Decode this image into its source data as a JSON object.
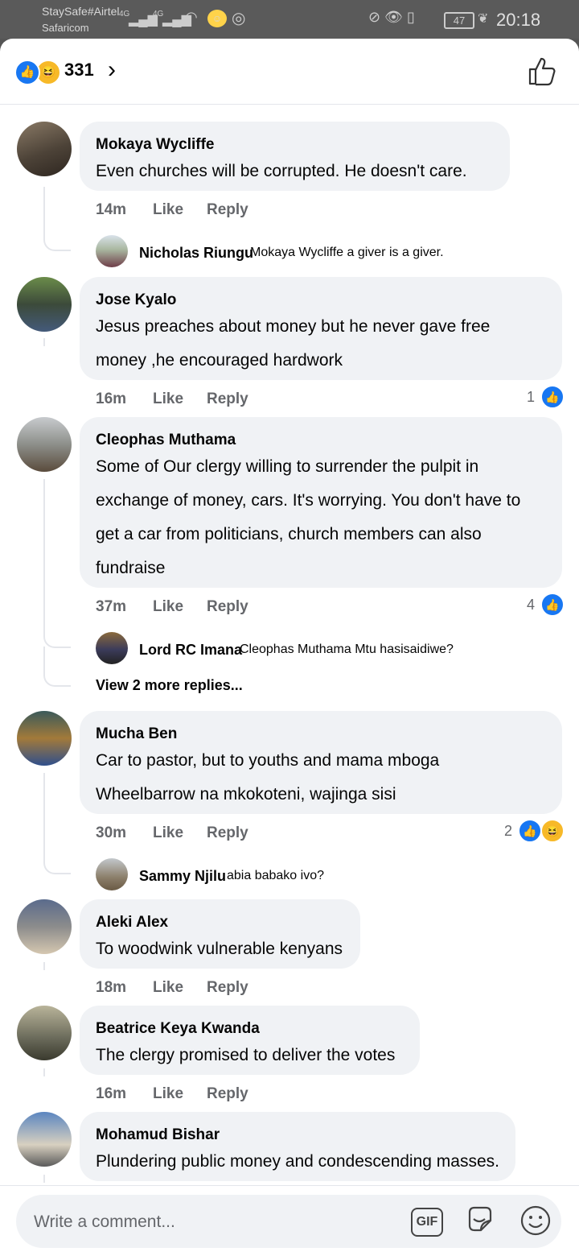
{
  "status_bar": {
    "carrier1": "StaySafe#Airtel",
    "carrier2": "Safaricom",
    "signal1": "4G",
    "signal2": "4G",
    "battery": "47",
    "time": "20:18"
  },
  "header": {
    "reaction_count": "331",
    "like_icon": "thumbs-up-icon"
  },
  "comments": [
    {
      "name": "Mokaya Wycliffe",
      "text": "Even  churches  will be  corrupted. He  doesn't  care.",
      "time": "14m",
      "like": "Like",
      "reply": "Reply",
      "replies": [
        {
          "name": "Nicholas Riungu",
          "text": "Mokaya Wycliffe a giver is a giver."
        }
      ]
    },
    {
      "name": "Jose Kyalo",
      "text": "Jesus preaches about money but he never gave free\nmoney ,he encouraged hardwork",
      "time": "16m",
      "like": "Like",
      "reply": "Reply",
      "reactions": "1"
    },
    {
      "name": "Cleophas Muthama",
      "text": "Some of Our clergy willing to surrender the pulpit in\nexchange of money, cars. It's worrying. You don't have to\nget a car from politicians, church members can also\nfundraise",
      "time": "37m",
      "like": "Like",
      "reply": "Reply",
      "reactions": "4",
      "replies": [
        {
          "name": "Lord RC Imana",
          "text": "Cleophas Muthama Mtu hasisaidiwe?"
        }
      ],
      "more_replies": "View 2 more replies..."
    },
    {
      "name": "Mucha Ben",
      "text": "Car to pastor, but to youths and mama mboga\nWheelbarrow na mkokoteni, wajinga sisi",
      "time": "30m",
      "like": "Like",
      "reply": "Reply",
      "reactions": "2",
      "replies": [
        {
          "name": "Sammy Njilu",
          "text": "abia babako ivo?"
        }
      ]
    },
    {
      "name": "Aleki Alex",
      "text": "To woodwink vulnerable kenyans",
      "time": "18m",
      "like": "Like",
      "reply": "Reply"
    },
    {
      "name": "Beatrice Keya Kwanda",
      "text": "The clergy promised to deliver the votes",
      "time": "16m",
      "like": "Like",
      "reply": "Reply"
    },
    {
      "name": "Mohamud Bishar",
      "text": "Plundering public money and condescending masses."
    }
  ],
  "composer": {
    "placeholder": "Write a comment...",
    "gif_label": "GIF"
  },
  "colors": {
    "accent": "#1877f2",
    "bubble": "#f0f2f5",
    "meta_text": "#65676b",
    "haha": "#f7b928"
  }
}
